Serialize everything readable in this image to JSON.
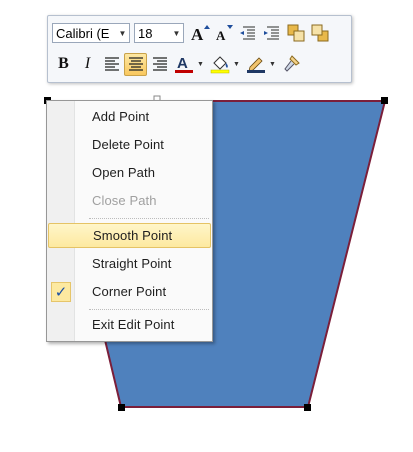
{
  "toolbar": {
    "font_name": "Calibri (E",
    "font_size": "18",
    "bold_label": "B",
    "italic_label": "I",
    "font_color": "#c00000",
    "highlight_color": "#ffff00",
    "outline_color": "#1f3864"
  },
  "context_menu": {
    "items": [
      {
        "label": "Add Point",
        "enabled": true
      },
      {
        "label": "Delete Point",
        "enabled": true
      },
      {
        "label": "Open Path",
        "enabled": true
      },
      {
        "label": "Close Path",
        "enabled": false
      },
      {
        "label": "Smooth Point",
        "enabled": true,
        "highlighted": true
      },
      {
        "label": "Straight Point",
        "enabled": true
      },
      {
        "label": "Corner Point",
        "enabled": true,
        "checked": true
      },
      {
        "label": "Exit Edit Point",
        "enabled": true
      }
    ]
  },
  "shape": {
    "fill": "#4f81bd",
    "outline": "#7b1f3a"
  }
}
